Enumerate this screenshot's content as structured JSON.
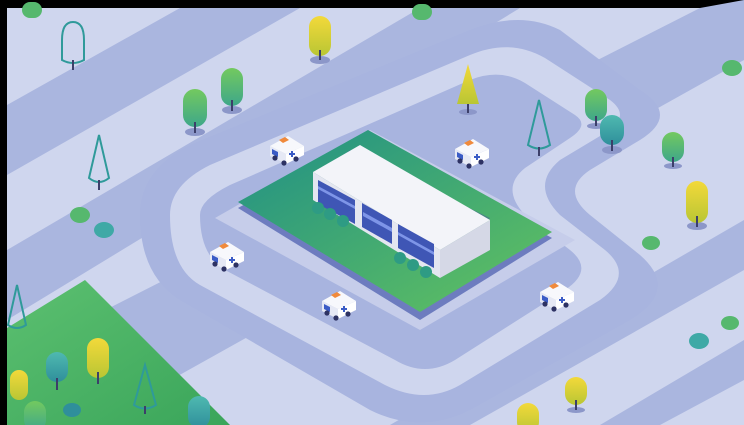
{
  "scene": {
    "subject": "isometric-hospital-illustration",
    "palette": {
      "frame": "#000000",
      "ground": "#cfd6ee",
      "road": "#a9b5df",
      "road_edge": "#bcc6e8",
      "lot": "#c3cbe9",
      "park": "#4fb86a",
      "park_dark": "#36a85a",
      "building_top": "#f2f3f8",
      "building_side": "#e3e5ef",
      "building_shadow": "#5a64a8",
      "glass": "#3f56b5",
      "glass_light": "#7e95e8",
      "platform_top": "#2e9b84",
      "platform_edge": "#6d7cbf",
      "tree_yellow": "#e6c72c",
      "tree_green": "#56b86e",
      "tree_teal": "#3fa9a6",
      "trunk": "#3c3f6a",
      "ambulance_body": "#f5f6fb",
      "ambulance_cross": "#3b5cc6",
      "ambulance_light": "#f08a3c"
    },
    "icons": [
      "hospital-building",
      "ambulance",
      "tree",
      "bush",
      "road"
    ]
  }
}
